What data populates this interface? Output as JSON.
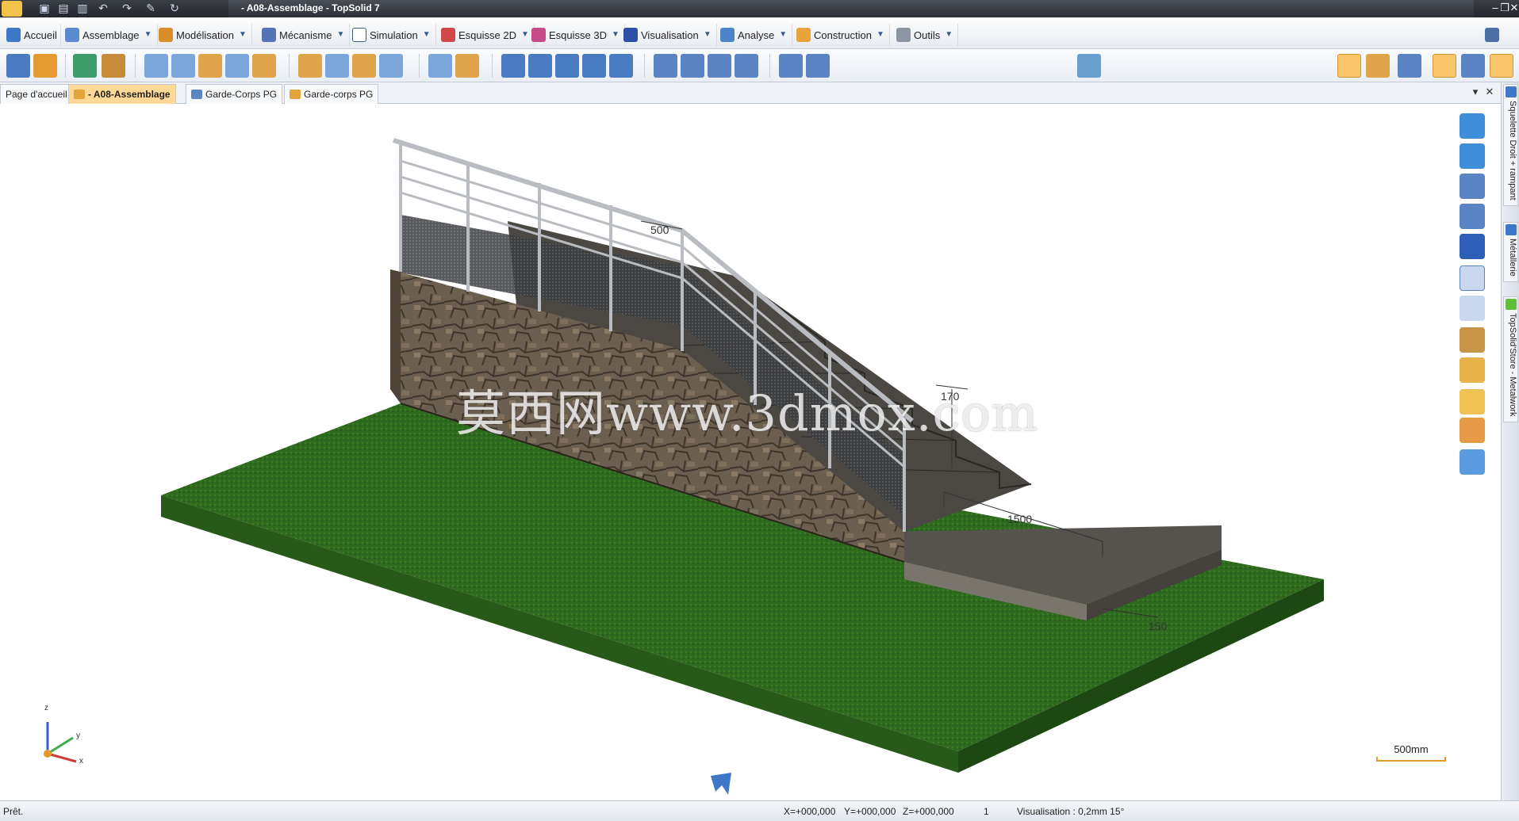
{
  "window": {
    "title": "- A08-Assemblage - TopSolid 7"
  },
  "ribbon": {
    "tabs": [
      {
        "label": "Accueil",
        "icon": "home-icon"
      },
      {
        "label": "Assemblage",
        "icon": "assembly-icon"
      },
      {
        "label": "Modélisation",
        "icon": "modeling-icon"
      },
      {
        "label": "Mécanisme",
        "icon": "mechanism-icon"
      },
      {
        "label": "Simulation",
        "icon": "simulation-icon"
      },
      {
        "label": "Esquisse 2D",
        "icon": "sketch-2d-icon"
      },
      {
        "label": "Esquisse 3D",
        "icon": "sketch-3d-icon"
      },
      {
        "label": "Visualisation",
        "icon": "display-icon"
      },
      {
        "label": "Analyse",
        "icon": "analysis-icon"
      },
      {
        "label": "Construction",
        "icon": "construction-icon"
      },
      {
        "label": "Outils",
        "icon": "tools-icon"
      }
    ]
  },
  "documents": {
    "tabs": [
      {
        "label": "Page d'accueil",
        "active": false
      },
      {
        "label": "- A08-Assemblage",
        "active": true
      },
      {
        "label": "Garde-Corps PG",
        "active": false
      },
      {
        "label": "Garde-corps PG",
        "active": false
      }
    ]
  },
  "viewport": {
    "watermark": "莫西网www.3dmox.com",
    "dimensions": [
      "500",
      "170",
      "1500",
      "150"
    ],
    "axes": {
      "z": "z",
      "y": "y",
      "x": "x"
    },
    "scale_label": "500mm",
    "colors": {
      "grass": "#2f6b1e",
      "stone": "#6b5f4f",
      "slab": "#56524d",
      "rail": "#b9bdc2",
      "accent": "#e39a2b"
    }
  },
  "side_panel": {
    "tabs": [
      "Squelette Droit + rampant",
      "Métallerie",
      "TopSolid'Store - Metalwork"
    ]
  },
  "status": {
    "ready": "Prêt.",
    "x": "X=+000,000",
    "y": "Y=+000,000",
    "z": "Z=+000,000",
    "count": "1",
    "visualisation": "Visualisation : 0,2mm 15°"
  }
}
